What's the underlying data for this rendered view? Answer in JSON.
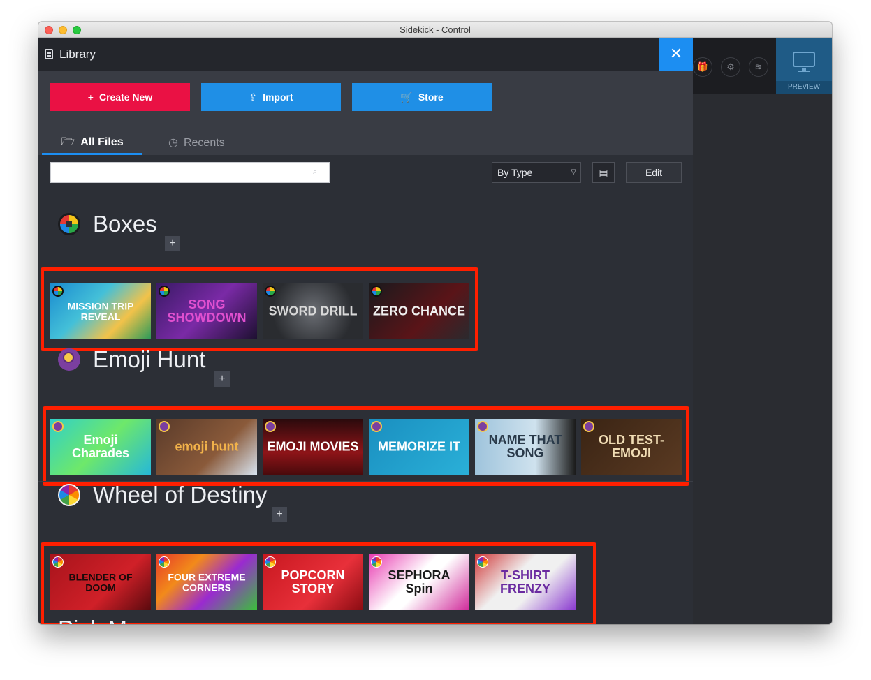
{
  "window": {
    "title": "Sidekick - Control"
  },
  "background_app": {
    "preview_label": "PREVIEW"
  },
  "library": {
    "title": "Library",
    "close_glyph": "✕",
    "actions": {
      "create_label": "Create New",
      "import_label": "Import",
      "store_label": "Store"
    },
    "tabs": [
      {
        "label": "All Files",
        "active": true
      },
      {
        "label": "Recents",
        "active": false
      }
    ],
    "search": {
      "value": "",
      "placeholder": ""
    },
    "sort": {
      "selected": "By Type"
    },
    "edit_label": "Edit"
  },
  "sections": [
    {
      "title": "Boxes",
      "items": [
        {
          "label": "MISSION TRIP REVEAL",
          "bg": "linear-gradient(135deg,#1a8bd0,#44c0d8 40%,#f2c24a 70%,#2a9a5a)",
          "color": "#ffffff"
        },
        {
          "label": "SONG SHOWDOWN",
          "bg": "linear-gradient(135deg,#3a1a66,#7a2aa6 50%,#1d1030)",
          "color": "#e04fcf"
        },
        {
          "label": "SWORD DRILL",
          "bg": "radial-gradient(circle,#6b6e74,#2a2c30 70%)",
          "color": "#d8d8d8"
        },
        {
          "label": "ZERO CHANCE",
          "bg": "linear-gradient(135deg,#1a1a1d,#5a1418 60%,#2a2a2e)",
          "color": "#f0f0f0"
        }
      ]
    },
    {
      "title": "Emoji Hunt",
      "items": [
        {
          "label": "Emoji Charades",
          "bg": "linear-gradient(135deg,#31d0c8,#6ee86a 50%,#26b8d8)",
          "color": "#ffffff"
        },
        {
          "label": "emoji hunt",
          "bg": "linear-gradient(135deg,#5a3b2a,#8a5a3a 60%,#d8e4f0)",
          "color": "#f2b24a"
        },
        {
          "label": "EMOJI MOVIES",
          "bg": "linear-gradient(180deg,#2a0a0c,#8e1418 60%,#4a0a0c)",
          "color": "#ffffff"
        },
        {
          "label": "MEMORIZE IT",
          "bg": "linear-gradient(135deg,#1a8fc0,#2ab0d8)",
          "color": "#ffffff"
        },
        {
          "label": "NAME THAT SONG",
          "bg": "linear-gradient(90deg,#9fc4dc,#cfe2ee 60%,#1a1a1a)",
          "color": "#2a3a4a"
        },
        {
          "label": "OLD TEST-EMOJI",
          "bg": "linear-gradient(135deg,#3a2414,#5a3a22)",
          "color": "#f0dcb4"
        }
      ]
    },
    {
      "title": "Wheel of Destiny",
      "items": [
        {
          "label": "BLENDER OF DOOM",
          "bg": "linear-gradient(135deg,#a8141c,#d02028 60%,#5a0a0e)",
          "color": "#1a0a0a"
        },
        {
          "label": "FOUR EXTREME CORNERS",
          "bg": "linear-gradient(135deg,#e63a2a,#f28a1a 30%,#9a2ad0 60%,#3ac03a)",
          "color": "#ffffff"
        },
        {
          "label": "POPCORN STORY",
          "bg": "linear-gradient(135deg,#c81820,#e8303a 60%,#8a0c12)",
          "color": "#ffffff"
        },
        {
          "label": "SEPHORA Spin",
          "bg": "linear-gradient(135deg,#e83ab0,#ffffff 45%,#ffffff 55%,#d02a9a)",
          "color": "#1a1a1a"
        },
        {
          "label": "T-SHIRT FRENZY",
          "bg": "linear-gradient(135deg,#d03a3a,#f0f0f0 40%,#f0f0f0 60%,#8a3ad0)",
          "color": "#6a2aa0"
        }
      ]
    }
  ],
  "next_section_partial": "Pick Me"
}
